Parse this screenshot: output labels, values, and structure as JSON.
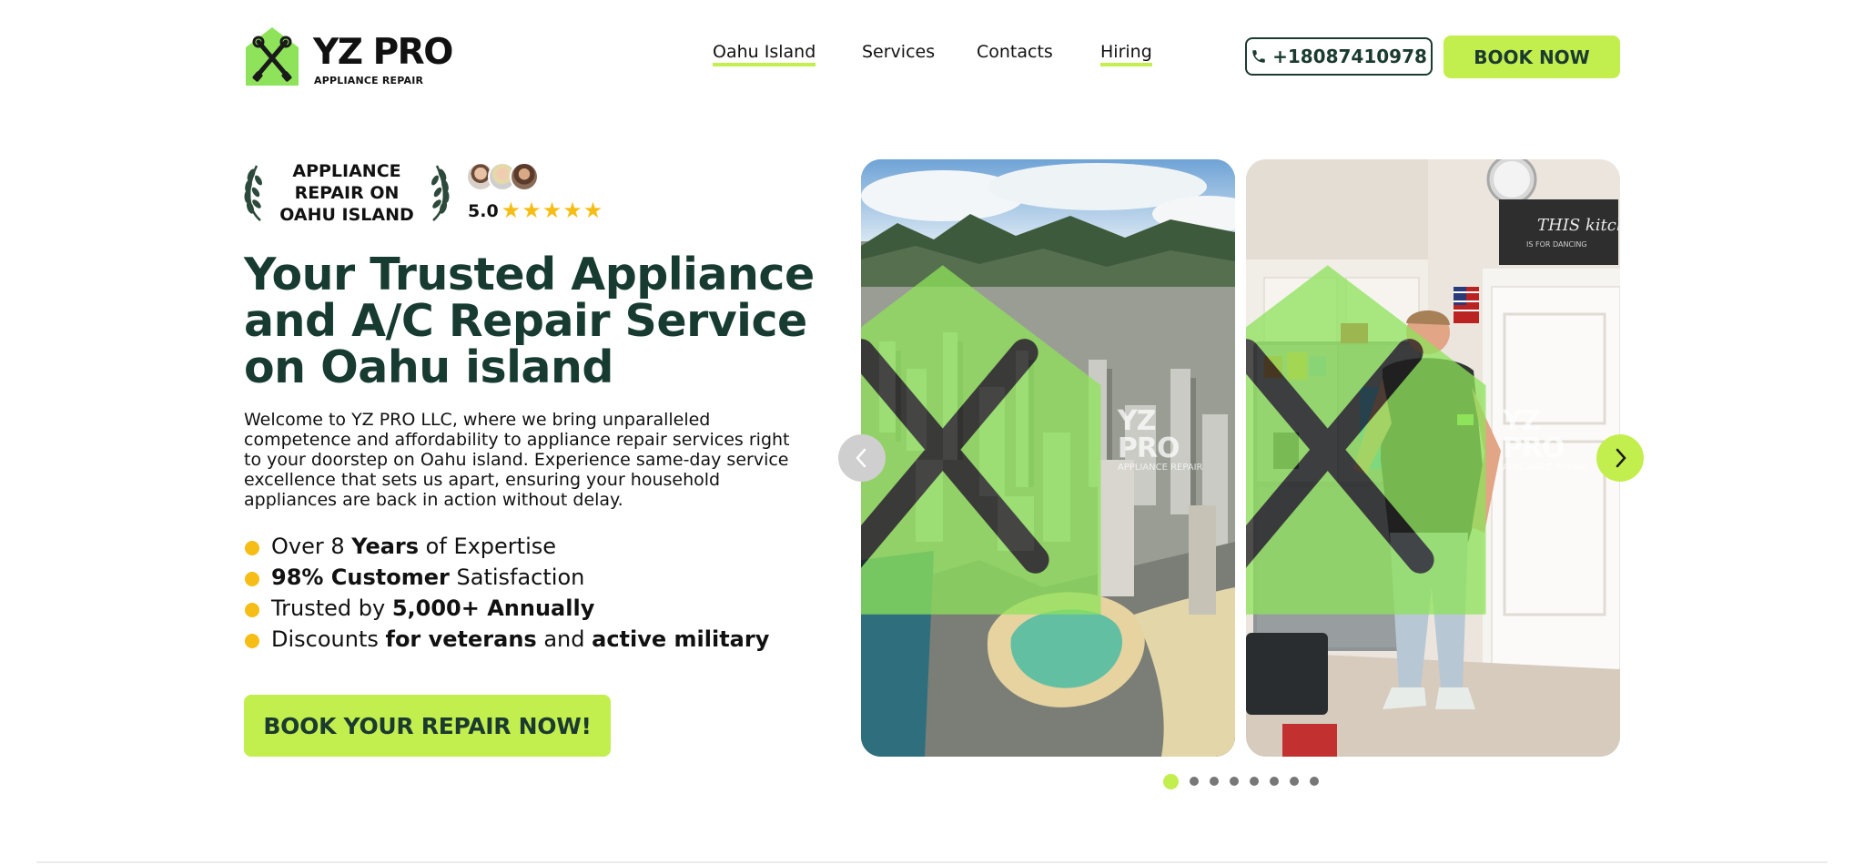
{
  "brand": {
    "name": "YZ PRO",
    "tagline": "APPLIANCE REPAIR",
    "accent": "#c2ef4e",
    "dark": "#173b30",
    "star_color": "#f6bd16"
  },
  "nav": {
    "items": [
      {
        "label": "Oahu Island",
        "active": true
      },
      {
        "label": "Services"
      },
      {
        "label": "Contacts"
      },
      {
        "label": "Hiring",
        "active": true
      }
    ]
  },
  "header": {
    "phone": "+18087410978",
    "phone_icon": "phone-icon",
    "book_label": "BOOK NOW"
  },
  "award": {
    "lines": [
      "APPLIANCE",
      "REPAIR ON",
      "OAHU ISLAND"
    ]
  },
  "reviews": {
    "rating": "5.0",
    "stars": "★★★★★",
    "star_count": 5
  },
  "hero": {
    "title_lines": [
      "Your Trusted Appliance",
      "and A/C Repair Service",
      "on Oahu island"
    ],
    "description": "Welcome to YZ PRO LLC, where we bring unparalleled competence and affordability to appliance repair services right to your doorstep on Oahu island. Experience same-day service excellence that sets us apart, ensuring your household appliances are back in action without delay.",
    "features": [
      {
        "pre": "Over 8 ",
        "bold": "Years",
        "post": " of Expertise"
      },
      {
        "pre": "",
        "bold": "98% Customer",
        "post": " Satisfaction"
      },
      {
        "pre": "Trusted by ",
        "bold": "5,000+ Annually",
        "post": ""
      },
      {
        "pre": "Discounts ",
        "bold": "for veterans",
        "mid": " and ",
        "bold2": "active military",
        "post": ""
      }
    ],
    "cta_label": "BOOK YOUR REPAIR NOW!"
  },
  "carousel": {
    "watermark_name": "YZ PRO",
    "watermark_sub": "APPLIANCE REPAIR",
    "kitchen_sign_lines": [
      "THIS kitchen",
      "IS FOR DANCING"
    ],
    "slide_count": 8,
    "active_slide": 1
  }
}
